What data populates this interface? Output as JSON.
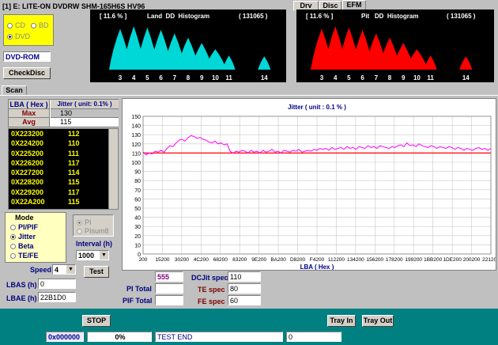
{
  "title": {
    "drive": "[1]  E: LITE-ON DVDRW SHM-165H6S    HV96"
  },
  "disc_type": {
    "cd": "CD",
    "bd": "BD",
    "dvd": "DVD",
    "selected": "DVD"
  },
  "disc_label": "DVD-ROM",
  "check_disc_btn": "CheckDisc",
  "land_hist": {
    "pct": "[ 11.6 % ]",
    "title": "Land  DD  Histogram",
    "count": "( 131065 )",
    "ticks": [
      "3",
      "4",
      "5",
      "6",
      "7",
      "8",
      "9",
      "10",
      "11",
      "14"
    ],
    "color": "#00d8d8"
  },
  "pit_hist": {
    "pct": "[ 11.6 % ]",
    "title": "Pit   DD  Histogram",
    "count": "( 131065 )",
    "ticks": [
      "3",
      "4",
      "5",
      "6",
      "7",
      "8",
      "9",
      "10",
      "11",
      "14"
    ],
    "color": "#ff0000"
  },
  "tabs": {
    "drv_sel": "Drv Sel",
    "disc": "Disc",
    "efm": "EFM",
    "scan": "Scan"
  },
  "table": {
    "lba_header": "LBA  ( Hex )",
    "jitter_header": "Jitter ( unit: 0.1% )",
    "max_label": "Max",
    "max_value": "130",
    "avg_label": "Avg",
    "avg_value": "115",
    "rows": [
      {
        "lba": "0X223200",
        "val": "112"
      },
      {
        "lba": "0X224200",
        "val": "110"
      },
      {
        "lba": "0X225200",
        "val": "111"
      },
      {
        "lba": "0X226200",
        "val": "117"
      },
      {
        "lba": "0X227200",
        "val": "114"
      },
      {
        "lba": "0X228200",
        "val": "115"
      },
      {
        "lba": "0X229200",
        "val": "117"
      },
      {
        "lba": "0X22A200",
        "val": "115"
      }
    ]
  },
  "mode": {
    "label": "Mode",
    "options": [
      "PI/PIF",
      "Jitter",
      "Beta",
      "TE/FE"
    ],
    "selected": "Jitter",
    "pi": "PI",
    "pisum8": "PIsum8",
    "interval_label": "Interval (h)",
    "interval_value": "1000"
  },
  "speed": {
    "label": "Speed",
    "value": "4"
  },
  "test_btn": "Test",
  "lbas": {
    "label": "LBAS (h)",
    "value": "0"
  },
  "lbae": {
    "label": "LBAE (h)",
    "value": "22B1D0"
  },
  "stats": {
    "top_value": "555",
    "pi_total_label": "PI  Total",
    "pi_total": "",
    "pif_total_label": "PIF Total",
    "pif_total": "",
    "dcjit_label": "DCJit spec",
    "dcjit": "110",
    "te_label": "TE spec",
    "te": "80",
    "fe_label": "FE spec",
    "fe": "60"
  },
  "bottom": {
    "stop": "STOP",
    "tray_in": "Tray In",
    "tray_out": "Tray Out"
  },
  "status": {
    "lba": "0x000000",
    "pct": "0%",
    "msg": "TEST END",
    "count": "0"
  },
  "chart_data": {
    "type": "line",
    "title": "Jitter   ( unit : 0.1 % )",
    "xlabel": "LBA  ( Hex )",
    "ylabel": "",
    "ylim": [
      0,
      150
    ],
    "yticks": [
      0,
      10,
      20,
      30,
      40,
      50,
      60,
      70,
      80,
      90,
      100,
      110,
      120,
      130,
      140,
      150
    ],
    "xticks": [
      "200",
      "15200",
      "30200",
      "4C200",
      "68200",
      "83200",
      "9E200",
      "BA200",
      "D8200",
      "F4200",
      "112200",
      "134200",
      "156200",
      "178200",
      "199200",
      "1BB200",
      "1DE200",
      "200200",
      "221200"
    ],
    "threshold": 110,
    "grid": true,
    "colors": {
      "line": "#ff00ff",
      "threshold": "#ff0000"
    },
    "series": [
      {
        "values": [
          111,
          108,
          110,
          109,
          112,
          111,
          113,
          111,
          115,
          118,
          117,
          121,
          124,
          125,
          123,
          127,
          129,
          128,
          126,
          127,
          125,
          124,
          122,
          121,
          123,
          120,
          121,
          119,
          120,
          112,
          110,
          112,
          111,
          113,
          112,
          110,
          113,
          111,
          112,
          110,
          113,
          111,
          112,
          114,
          111,
          112,
          110,
          113,
          112,
          111,
          113,
          112,
          114,
          111,
          112,
          113,
          112,
          114,
          113,
          115,
          114,
          115,
          113,
          116,
          114,
          115,
          116,
          114,
          117,
          115,
          116,
          114,
          117,
          116,
          115,
          118,
          116,
          117,
          115,
          118,
          117,
          116,
          115,
          117,
          116,
          118,
          119,
          117,
          121,
          118,
          119,
          117,
          120,
          118,
          117,
          116,
          118,
          117,
          115,
          117,
          116,
          115,
          117,
          116,
          114,
          116,
          115,
          113,
          115,
          114,
          113,
          115,
          116,
          114,
          115,
          113,
          115
        ]
      }
    ]
  }
}
